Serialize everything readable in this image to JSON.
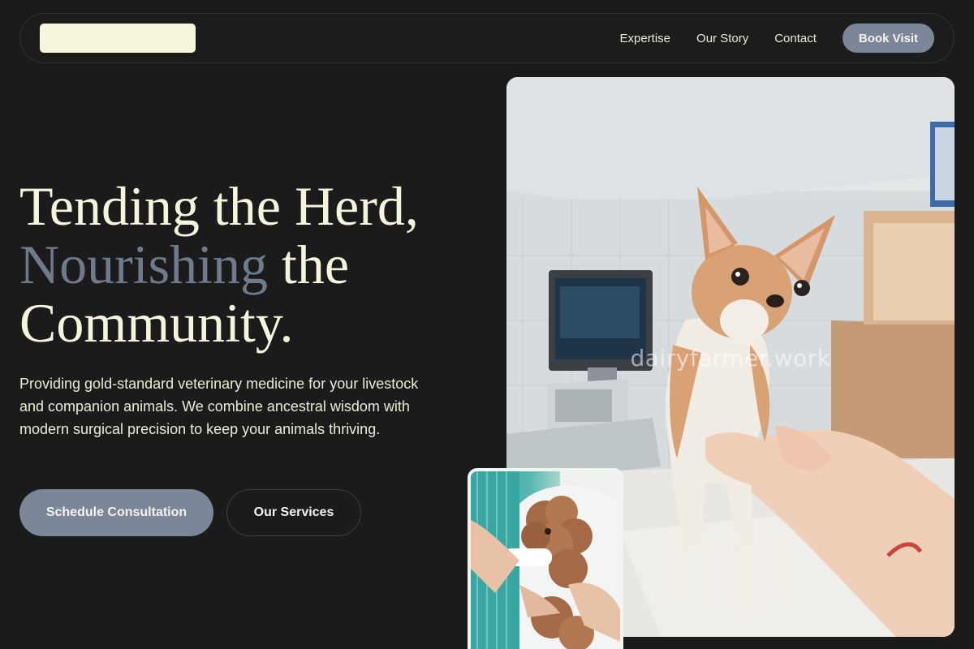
{
  "nav": {
    "links": [
      "Expertise",
      "Our Story",
      "Contact"
    ],
    "book_label": "Book Visit"
  },
  "hero": {
    "title_line1": "Tending the Herd,",
    "title_accent": "Nourishing",
    "title_line2_rest": " the",
    "title_line3": "Community.",
    "description": "Providing gold-standard veterinary medicine for your livestock and companion animals. We combine ancestral wisdom with modern surgical precision to keep your animals thriving.",
    "primary_cta": "Schedule Consultation",
    "secondary_cta": "Our Services"
  },
  "images": {
    "watermark": "dairyfarmer.work"
  },
  "colors": {
    "background": "#1b1b1b",
    "cream": "#f6f4dc",
    "accent_slate": "#7b8799"
  }
}
